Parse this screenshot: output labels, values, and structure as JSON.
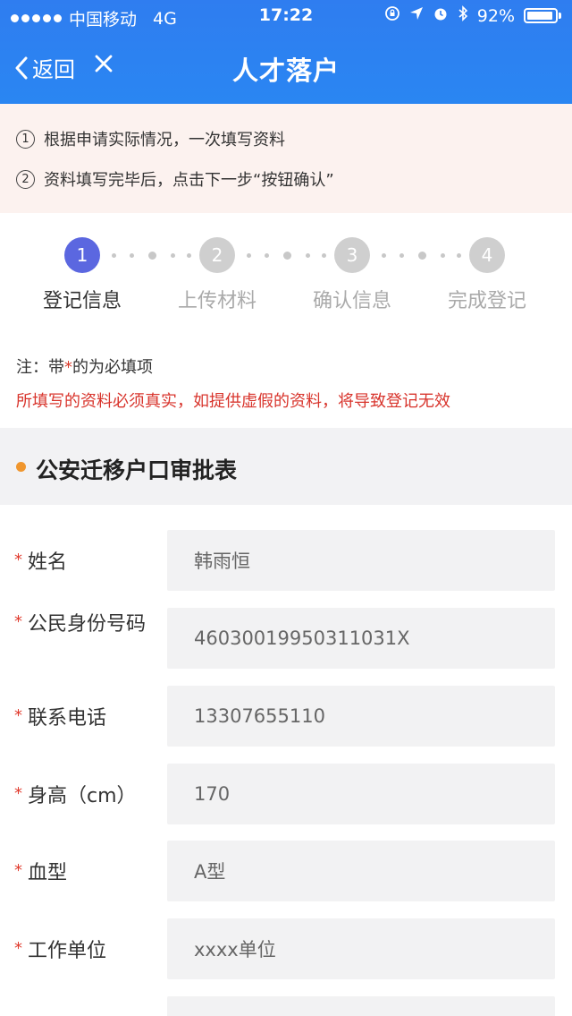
{
  "status_bar": {
    "carrier": "中国移动",
    "network": "4G",
    "time": "17:22",
    "battery": "92%",
    "battery_level": 0.92
  },
  "nav": {
    "back_label": "返回",
    "title": "人才落户"
  },
  "notice": {
    "items": [
      {
        "num": "1",
        "text": "根据申请实际情况，一次填写资料"
      },
      {
        "num": "2",
        "text": "资料填写完毕后，点击下一步“按钮确认”"
      }
    ]
  },
  "stepper": {
    "steps": [
      {
        "num": "1",
        "label": "登记信息",
        "active": true
      },
      {
        "num": "2",
        "label": "上传材料",
        "active": false
      },
      {
        "num": "3",
        "label": "确认信息",
        "active": false
      },
      {
        "num": "4",
        "label": "完成登记",
        "active": false
      }
    ]
  },
  "notes": {
    "prefix": "注：带",
    "star": "*",
    "suffix": "的为必填项",
    "warning": "所填写的资料必须真实，如提供虚假的资料，将导致登记无效"
  },
  "section": {
    "title": "公安迁移户口审批表"
  },
  "form": {
    "required_mark": "*",
    "rows": [
      {
        "label": "姓名",
        "value": "韩雨恒"
      },
      {
        "label": "公民身份号码",
        "value": "46030019950311031X"
      },
      {
        "label": "联系电话",
        "value": "13307655110"
      },
      {
        "label": "身高（cm）",
        "value": "170"
      },
      {
        "label": "血型",
        "value": "A型"
      },
      {
        "label": "工作单位",
        "value": "xxxx单位"
      }
    ]
  },
  "colors": {
    "header_blue": "#2f7df0",
    "step_active": "#5b67e0",
    "required_red": "#e03a2d",
    "warning_red": "#d8342c",
    "section_bullet": "#f0962e"
  },
  "icons": [
    "signal-dots-icon",
    "lock-rotation-icon",
    "location-arrow-icon",
    "alarm-icon",
    "bluetooth-icon",
    "battery-icon",
    "back-chevron-icon",
    "close-icon"
  ]
}
